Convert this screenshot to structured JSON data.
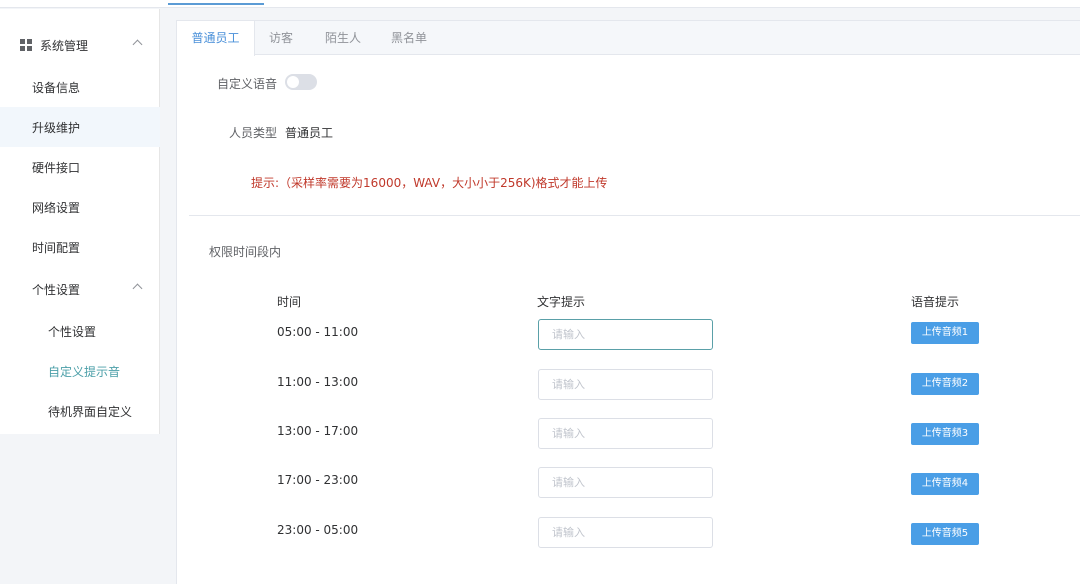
{
  "sidebar": {
    "group_system": "系统管理",
    "items": [
      "设备信息",
      "升级维护",
      "硬件接口",
      "网络设置",
      "时间配置"
    ],
    "group_personal": "个性设置",
    "sub_items": [
      "个性设置",
      "自定义提示音",
      "待机界面自定义"
    ]
  },
  "tabs": [
    "普通员工",
    "访客",
    "陌生人",
    "黑名单"
  ],
  "form": {
    "custom_voice_label": "自定义语音",
    "custom_voice_on": false,
    "person_type_label": "人员类型",
    "person_type_value": "普通员工",
    "hint": "提示:（采样率需要为16000，WAV，大小小于256K)格式才能上传"
  },
  "section": {
    "title": "权限时间段内",
    "col_time": "时间",
    "col_text": "文字提示",
    "col_voice": "语音提示"
  },
  "rows": [
    {
      "time": "05:00 - 11:00",
      "placeholder": "请输入",
      "button": "上传音频1"
    },
    {
      "time": "11:00 - 13:00",
      "placeholder": "请输入",
      "button": "上传音频2"
    },
    {
      "time": "13:00 - 17:00",
      "placeholder": "请输入",
      "button": "上传音频3"
    },
    {
      "time": "17:00 - 23:00",
      "placeholder": "请输入",
      "button": "上传音频4"
    },
    {
      "time": "23:00 - 05:00",
      "placeholder": "请输入",
      "button": "上传音频5"
    }
  ],
  "colors": {
    "accent": "#4a9ee6",
    "active_teal": "#4b9fa8",
    "hint_red": "#c0392b"
  }
}
